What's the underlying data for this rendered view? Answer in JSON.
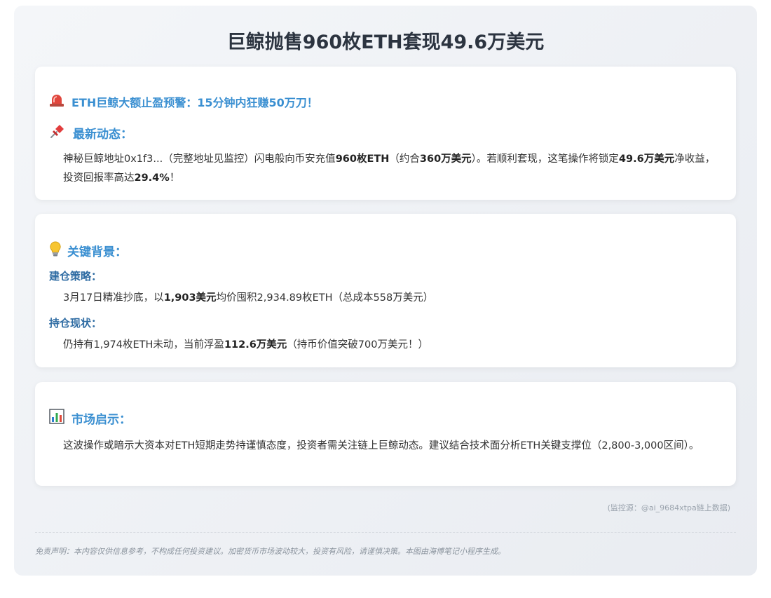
{
  "title": "巨鲸抛售960枚ETH套现49.6万美元",
  "alert": {
    "icon": "siren-icon",
    "heading": "ETH巨鲸大额止盈预警：15分钟内狂赚50万刀！"
  },
  "latest": {
    "icon": "pushpin-icon",
    "heading": "最新动态：",
    "p1": "神秘巨鲸地址0x1f3...（完整地址见监控）闪电般向币安充值",
    "b1": "960枚ETH",
    "p2": "（约合",
    "b2": "360万美元",
    "p3": "）。若顺利套现，这笔操作将锁定",
    "b3": "49.6万美元",
    "p4": "净收益，投资回报率高达",
    "b4": "29.4%",
    "p5": "！"
  },
  "background": {
    "icon": "lightbulb-icon",
    "heading": "关键背景：",
    "strategy_label": "建仓策略：",
    "strategy_p1": "3月17日精准抄底，以",
    "strategy_b1": "1,903美元",
    "strategy_p2": "均价囤积2,934.89枚ETH（总成本558万美元）",
    "holding_label": "持仓现状：",
    "holding_p1": "仍持有1,974枚ETH未动，当前浮盈",
    "holding_b1": "112.6万美元",
    "holding_p2": "（持币价值突破700万美元！）"
  },
  "market": {
    "icon": "bar-chart-icon",
    "heading": "市场启示：",
    "text": "这波操作或暗示大资本对ETH短期走势持谨慎态度，投资者需关注链上巨鲸动态。建议结合技术面分析ETH关键支撑位（2,800-3,000区间）。"
  },
  "source": "(监控源：@ai_9684xtpa链上数据)",
  "disclaimer": "免责声明：本内容仅供信息参考，不构成任何投资建议。加密货币市场波动较大，投资有风险，请谨慎决策。本图由海博笔记小程序生成。",
  "colors": {
    "accent": "#3a8fd1",
    "subheading": "#2f6ca3",
    "title": "#2c3440"
  }
}
